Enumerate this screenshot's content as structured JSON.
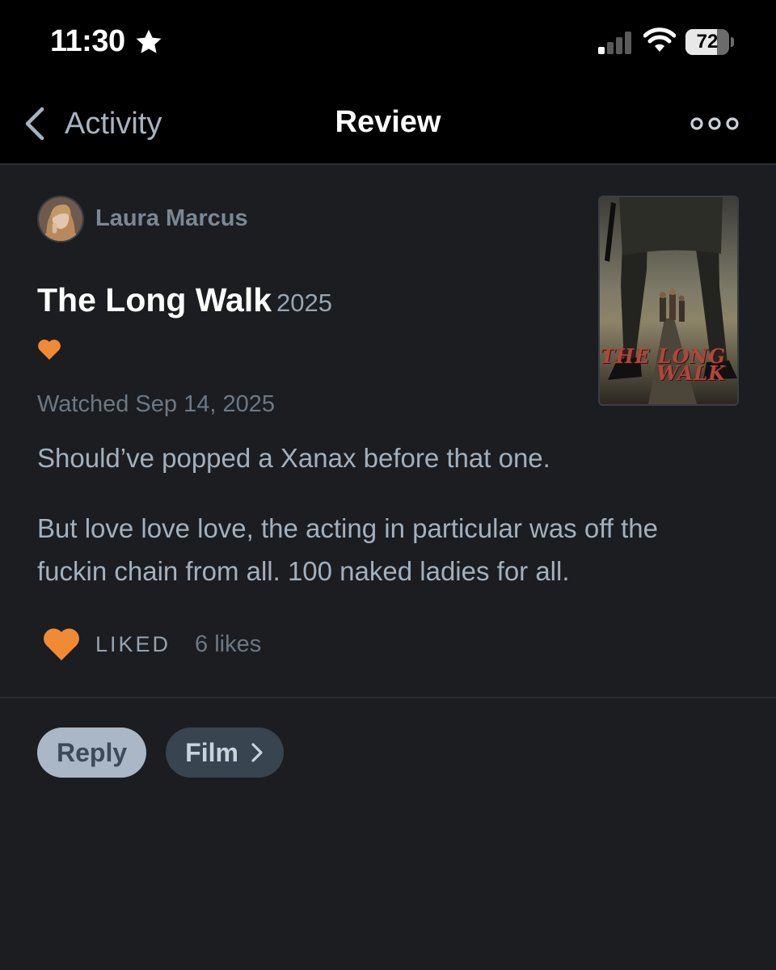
{
  "status_bar": {
    "time": "11:30",
    "battery_percent": "72",
    "battery_level": 0.72,
    "icons": [
      "star-icon",
      "signal-icon",
      "wifi-icon",
      "battery-icon"
    ]
  },
  "nav": {
    "back_label": "Activity",
    "title": "Review",
    "more_icon": "more-dots-icon"
  },
  "review": {
    "author": "Laura Marcus",
    "film_title": "The Long Walk",
    "film_year": "2025",
    "rating_icon": "heart-icon",
    "watched": "Watched Sep 14, 2025",
    "paragraphs": [
      "Should’ve popped a Xanax before that one.",
      "But love love love, the acting in particular was off the fuckin chain from all. 100 naked ladies for all."
    ],
    "liked_label": "LIKED",
    "likes_count": "6 likes",
    "poster_title": "THE LONG WALK"
  },
  "actions": {
    "reply_label": "Reply",
    "film_label": "Film"
  },
  "colors": {
    "background": "#1b1d20",
    "bar": "#000000",
    "heart": "#f08a35",
    "reply_bg": "#a9b7c6",
    "film_bg": "#38444f"
  }
}
